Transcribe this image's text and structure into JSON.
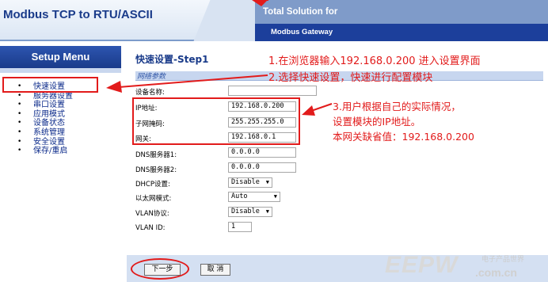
{
  "header": {
    "brand": "Modbus TCP to RTU/ASCII",
    "tagline": "Total Solution for",
    "subtitle": "Modbus Gateway"
  },
  "sidebar": {
    "title": "Setup Menu",
    "items": [
      {
        "label": "快速设置"
      },
      {
        "label": "服务器设置"
      },
      {
        "label": "串口设置"
      },
      {
        "label": "应用模式"
      },
      {
        "label": "设备状态"
      },
      {
        "label": "系统管理"
      },
      {
        "label": "安全设置"
      },
      {
        "label": "保存/重启"
      }
    ]
  },
  "main": {
    "step_title": "快速设置-Step1",
    "section": "网络参数",
    "fields": [
      {
        "label": "设备名称:",
        "value": ""
      },
      {
        "label": "IP地址:",
        "value": "192.168.0.200"
      },
      {
        "label": "子网掩码:",
        "value": "255.255.255.0"
      },
      {
        "label": "网关:",
        "value": "192.168.0.1"
      },
      {
        "label": "DNS服务器1:",
        "value": "0.0.0.0"
      },
      {
        "label": "DNS服务器2:",
        "value": "0.0.0.0"
      }
    ],
    "selects": [
      {
        "label": "DHCP设置:",
        "value": "Disable"
      },
      {
        "label": "以太网模式:",
        "value": "Auto"
      },
      {
        "label": "VLAN协议:",
        "value": "Disable"
      }
    ],
    "vlan_id": {
      "label": "VLAN ID:",
      "value": "1"
    },
    "buttons": {
      "next": "下一步",
      "cancel": "取 消"
    }
  },
  "annotations": {
    "step1": "1.在浏览器输入192.168.0.200 进入设置界面",
    "step2": "2.选择快速设置，快速进行配置模块",
    "step3_line1": "3.用户根据自己的实际情况，",
    "step3_line2": "设置模块的IP地址。",
    "step3_line3": "本网关缺省值：192.168.0.200"
  },
  "watermark": {
    "logo": "EEPW",
    "sub": "电子产品世界",
    "domain": ".com.cn"
  },
  "colors": {
    "annotation_red": "#e21b1b",
    "nav_blue": "#1a3b8a",
    "header_dark": "#1c3f9b"
  }
}
